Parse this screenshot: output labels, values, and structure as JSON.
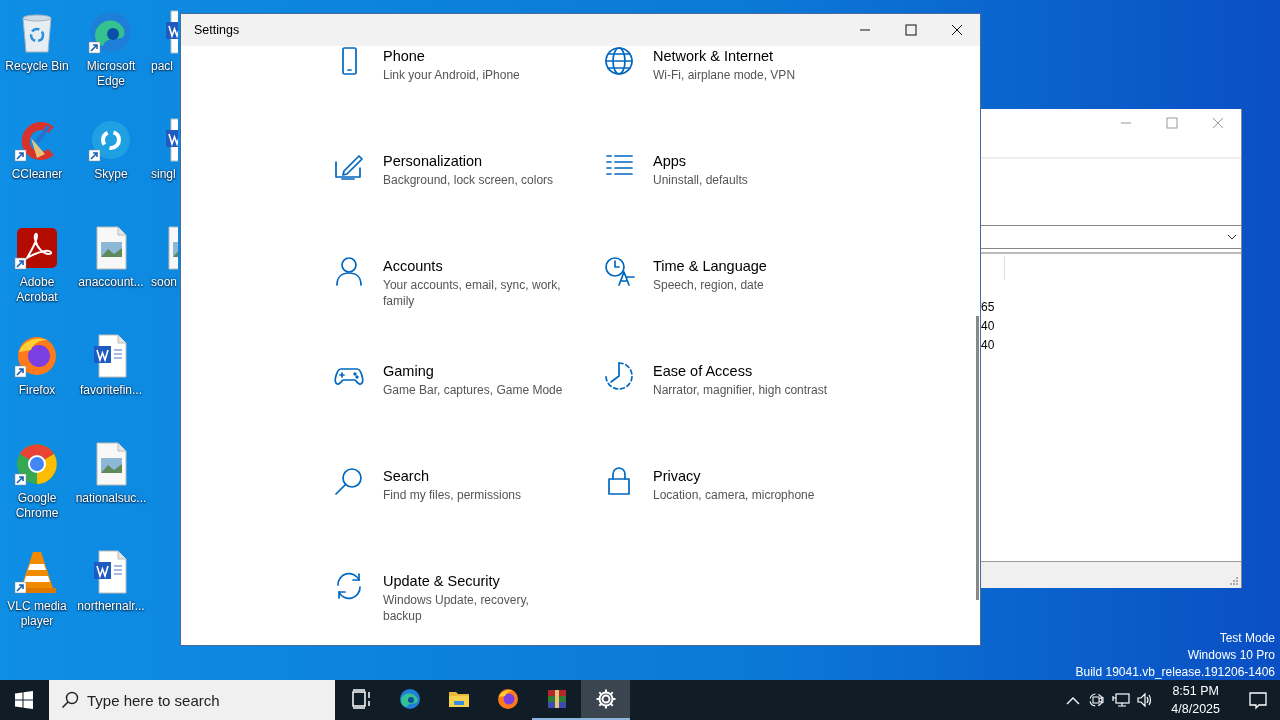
{
  "desktop_icons": [
    {
      "label": "Recycle Bin",
      "kind": "recycle",
      "shortcut": false
    },
    {
      "label": "CCleaner",
      "kind": "ccleaner",
      "shortcut": true
    },
    {
      "label": "Adobe Acrobat",
      "kind": "acrobat",
      "shortcut": true
    },
    {
      "label": "Firefox",
      "kind": "firefox",
      "shortcut": true
    },
    {
      "label": "Google Chrome",
      "kind": "chrome",
      "shortcut": true
    },
    {
      "label": "VLC media player",
      "kind": "vlc",
      "shortcut": true
    },
    {
      "label": "Microsoft Edge",
      "kind": "edge",
      "shortcut": true
    },
    {
      "label": "Skype",
      "kind": "skype",
      "shortcut": true
    },
    {
      "label": "anaccount...",
      "kind": "image",
      "shortcut": false
    },
    {
      "label": "favoritefin...",
      "kind": "word",
      "shortcut": false
    },
    {
      "label": "nationalsuc...",
      "kind": "image",
      "shortcut": false
    },
    {
      "label": "northernalr...",
      "kind": "word",
      "shortcut": false
    },
    {
      "label": "pacl",
      "kind": "word-partial",
      "shortcut": false
    },
    {
      "label": "singl",
      "kind": "word-partial",
      "shortcut": false
    },
    {
      "label": "soon",
      "kind": "image-partial",
      "shortcut": false
    }
  ],
  "background_window": {
    "values": [
      "65",
      "40",
      "40"
    ]
  },
  "settings_window": {
    "title": "Settings",
    "items": [
      {
        "kind": "phone",
        "title": "Phone",
        "description": "Link your Android, iPhone"
      },
      {
        "kind": "network",
        "title": "Network & Internet",
        "description": "Wi-Fi, airplane mode, VPN"
      },
      {
        "kind": "personalization",
        "title": "Personalization",
        "description": "Background, lock screen, colors"
      },
      {
        "kind": "apps",
        "title": "Apps",
        "description": "Uninstall, defaults"
      },
      {
        "kind": "accounts",
        "title": "Accounts",
        "description": "Your accounts, email, sync, work, family"
      },
      {
        "kind": "time",
        "title": "Time & Language",
        "description": "Speech, region, date"
      },
      {
        "kind": "gaming",
        "title": "Gaming",
        "description": "Game Bar, captures, Game Mode"
      },
      {
        "kind": "ease",
        "title": "Ease of Access",
        "description": "Narrator, magnifier, high contrast"
      },
      {
        "kind": "search",
        "title": "Search",
        "description": "Find my files, permissions"
      },
      {
        "kind": "privacy",
        "title": "Privacy",
        "description": "Location, camera, microphone"
      },
      {
        "kind": "update",
        "title": "Update & Security",
        "description": "Windows Update, recovery, backup"
      }
    ]
  },
  "system_info": [
    "Test Mode",
    "Windows 10 Pro",
    "Build 19041.vb_release.191206-1406"
  ],
  "taskbar": {
    "search": {
      "placeholder": "Type here to search"
    },
    "apps": [
      {
        "kind": "taskview",
        "running": false,
        "selected": false
      },
      {
        "kind": "edge",
        "running": false,
        "selected": false
      },
      {
        "kind": "explorer",
        "running": false,
        "selected": false
      },
      {
        "kind": "firefox",
        "running": false,
        "selected": false
      },
      {
        "kind": "winrar",
        "running": true,
        "selected": false
      },
      {
        "kind": "settings",
        "running": true,
        "selected": true
      }
    ],
    "clock": {
      "time": "8:51 PM",
      "date": "4/8/2025"
    }
  }
}
